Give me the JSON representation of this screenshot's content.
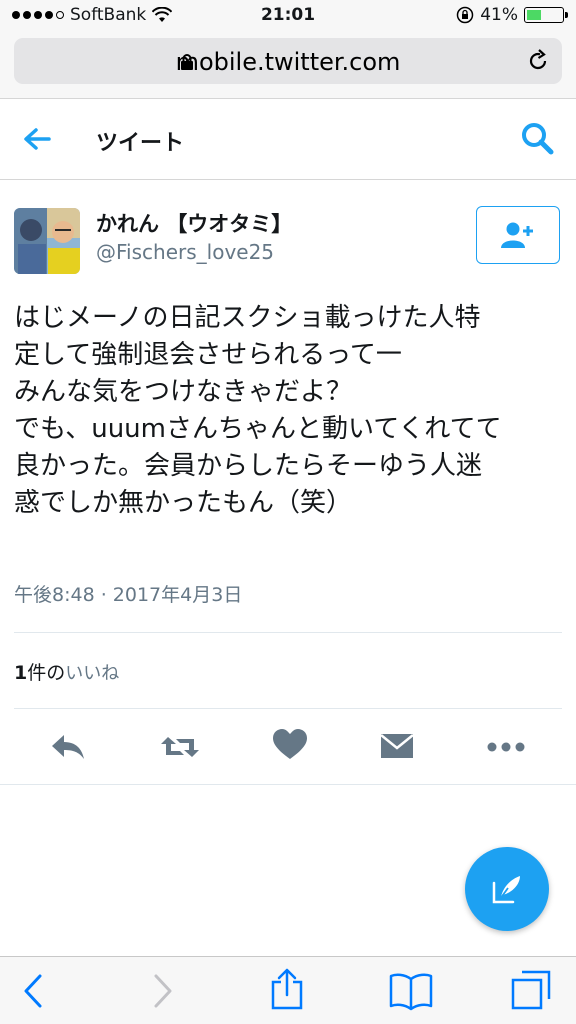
{
  "status_bar": {
    "carrier": "SoftBank",
    "time": "21:01",
    "battery_percent": "41%",
    "battery_level": 0.41,
    "signal_icon": "signal-dots-icon",
    "wifi_icon": "wifi-icon",
    "lock_icon": "orientation-lock-icon"
  },
  "browser": {
    "url": "mobile.twitter.com",
    "lock_icon": "lock-icon",
    "reload_icon": "reload-icon"
  },
  "header": {
    "title": "ツイート",
    "back_icon": "back-arrow-icon",
    "search_icon": "search-icon"
  },
  "tweet": {
    "display_name": "かれん 【ウオタミ】",
    "handle": "@Fischers_love25",
    "text": "はじメーノの日記スクショ載っけた人特\n定して強制退会させられるって一\nみんな気をつけなきゃだよ？\nでも、uuumさんちゃんと動いてくれてて\n良かった。会員からしたらそーゆう人迷\n惑でしか無かったもん（笑）",
    "timestamp": "午後8:48 · 2017年4月3日",
    "likes_count": "1",
    "likes_unit": "件の",
    "likes_label": "いいね"
  },
  "colors": {
    "accent": "#1da1f2",
    "icon_gray": "#657786",
    "text": "#14171a",
    "ios_blue": "#007aff"
  },
  "toolbar": {
    "icons": [
      "back-icon",
      "forward-icon",
      "share-icon",
      "bookmarks-icon",
      "tabs-icon"
    ]
  }
}
